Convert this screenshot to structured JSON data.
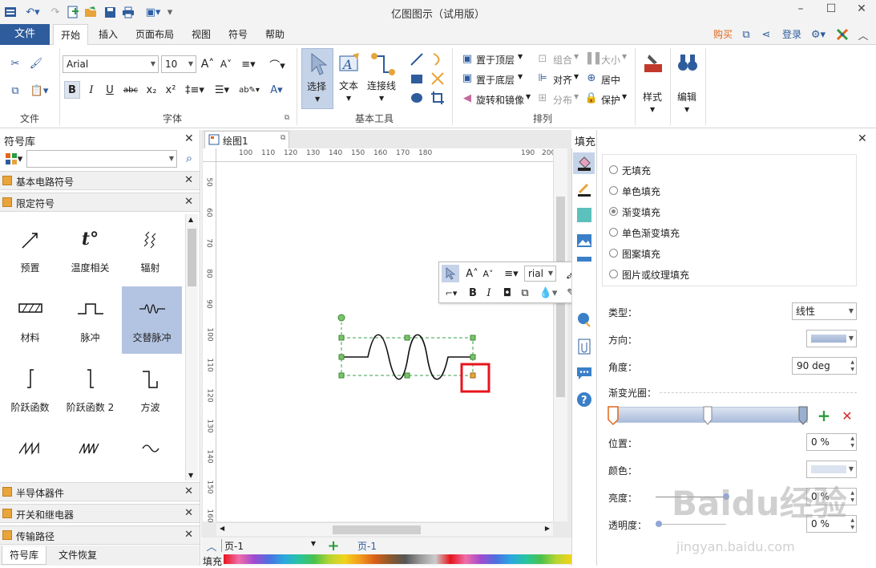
{
  "app": {
    "title": "亿图图示（试用版）"
  },
  "menu": {
    "file": "文件",
    "tabs": [
      "开始",
      "插入",
      "页面布局",
      "视图",
      "符号",
      "帮助"
    ],
    "buy": "购买",
    "login": "登录"
  },
  "ribbon": {
    "file_group": "文件",
    "font_group": "字体",
    "font_name": "Arial",
    "font_size": "10",
    "basic_tools_group": "基本工具",
    "select": "选择",
    "text": "文本",
    "connector": "连接线",
    "arrange_group": "排列",
    "bring_front": "置于顶层",
    "send_back": "置于底层",
    "rotate_mirror": "旋转和镜像",
    "group": "组合",
    "align": "对齐",
    "distribute": "分布",
    "size": "大小",
    "center": "居中",
    "protect": "保护",
    "style": "样式",
    "edit": "编辑"
  },
  "left_panel": {
    "title": "符号库",
    "libraries": [
      "基本电路符号",
      "限定符号"
    ],
    "bottom_libraries": [
      "半导体器件",
      "开关和继电器",
      "传输路径"
    ],
    "symbols": [
      {
        "label": "预置",
        "icon": "preset-icon"
      },
      {
        "label": "温度相关",
        "icon": "temperature-icon"
      },
      {
        "label": "辐射",
        "icon": "radiation-icon"
      },
      {
        "label": "材料",
        "icon": "material-icon"
      },
      {
        "label": "脉冲",
        "icon": "pulse-icon"
      },
      {
        "label": "交替脉冲",
        "icon": "alternating-pulse-icon"
      },
      {
        "label": "阶跃函数",
        "icon": "step-function-icon"
      },
      {
        "label": "阶跃函数 2",
        "icon": "step-function-2-icon"
      },
      {
        "label": "方波",
        "icon": "square-wave-icon"
      },
      {
        "label": "",
        "icon": "sawtooth-icon"
      },
      {
        "label": "",
        "icon": "sawtooth-2-icon"
      },
      {
        "label": "",
        "icon": "sine-icon"
      }
    ],
    "bottom_tabs": [
      "符号库",
      "文件恢复"
    ]
  },
  "canvas": {
    "doc_tab": "绘图1",
    "ruler_h": [
      "100",
      "110",
      "120",
      "130",
      "140",
      "150",
      "160",
      "170",
      "180",
      "190",
      "200"
    ],
    "ruler_v": [
      "50",
      "60",
      "70",
      "80",
      "90",
      "100",
      "110",
      "120",
      "130",
      "140",
      "150",
      "160"
    ],
    "float_font": "rial"
  },
  "status": {
    "page_select": "页-1",
    "page_tab": "页-1",
    "fill_label": "填充"
  },
  "fill_panel": {
    "title": "填充",
    "options": [
      "无填充",
      "单色填充",
      "渐变填充",
      "单色渐变填充",
      "图案填充",
      "图片或纹理填充"
    ],
    "selected_option": "渐变填充",
    "type_label": "类型：",
    "type_value": "线性",
    "direction_label": "方向：",
    "angle_label": "角度：",
    "angle_value": "90 deg",
    "gradient_stops_label": "渐变光圈：",
    "position_label": "位置：",
    "position_value": "0 %",
    "color_label": "颜色：",
    "brightness_label": "亮度：",
    "brightness_value": "0 %",
    "transparency_label": "透明度：",
    "transparency_value": "0 %"
  },
  "watermark": {
    "logo": "Baidu经验",
    "url": "jingyan.baidu.com"
  },
  "colors": {
    "accent": "#2e5c9c",
    "selection": "#b3c4e2",
    "highlight_box": "#e8141c",
    "buy": "#e0661c"
  }
}
